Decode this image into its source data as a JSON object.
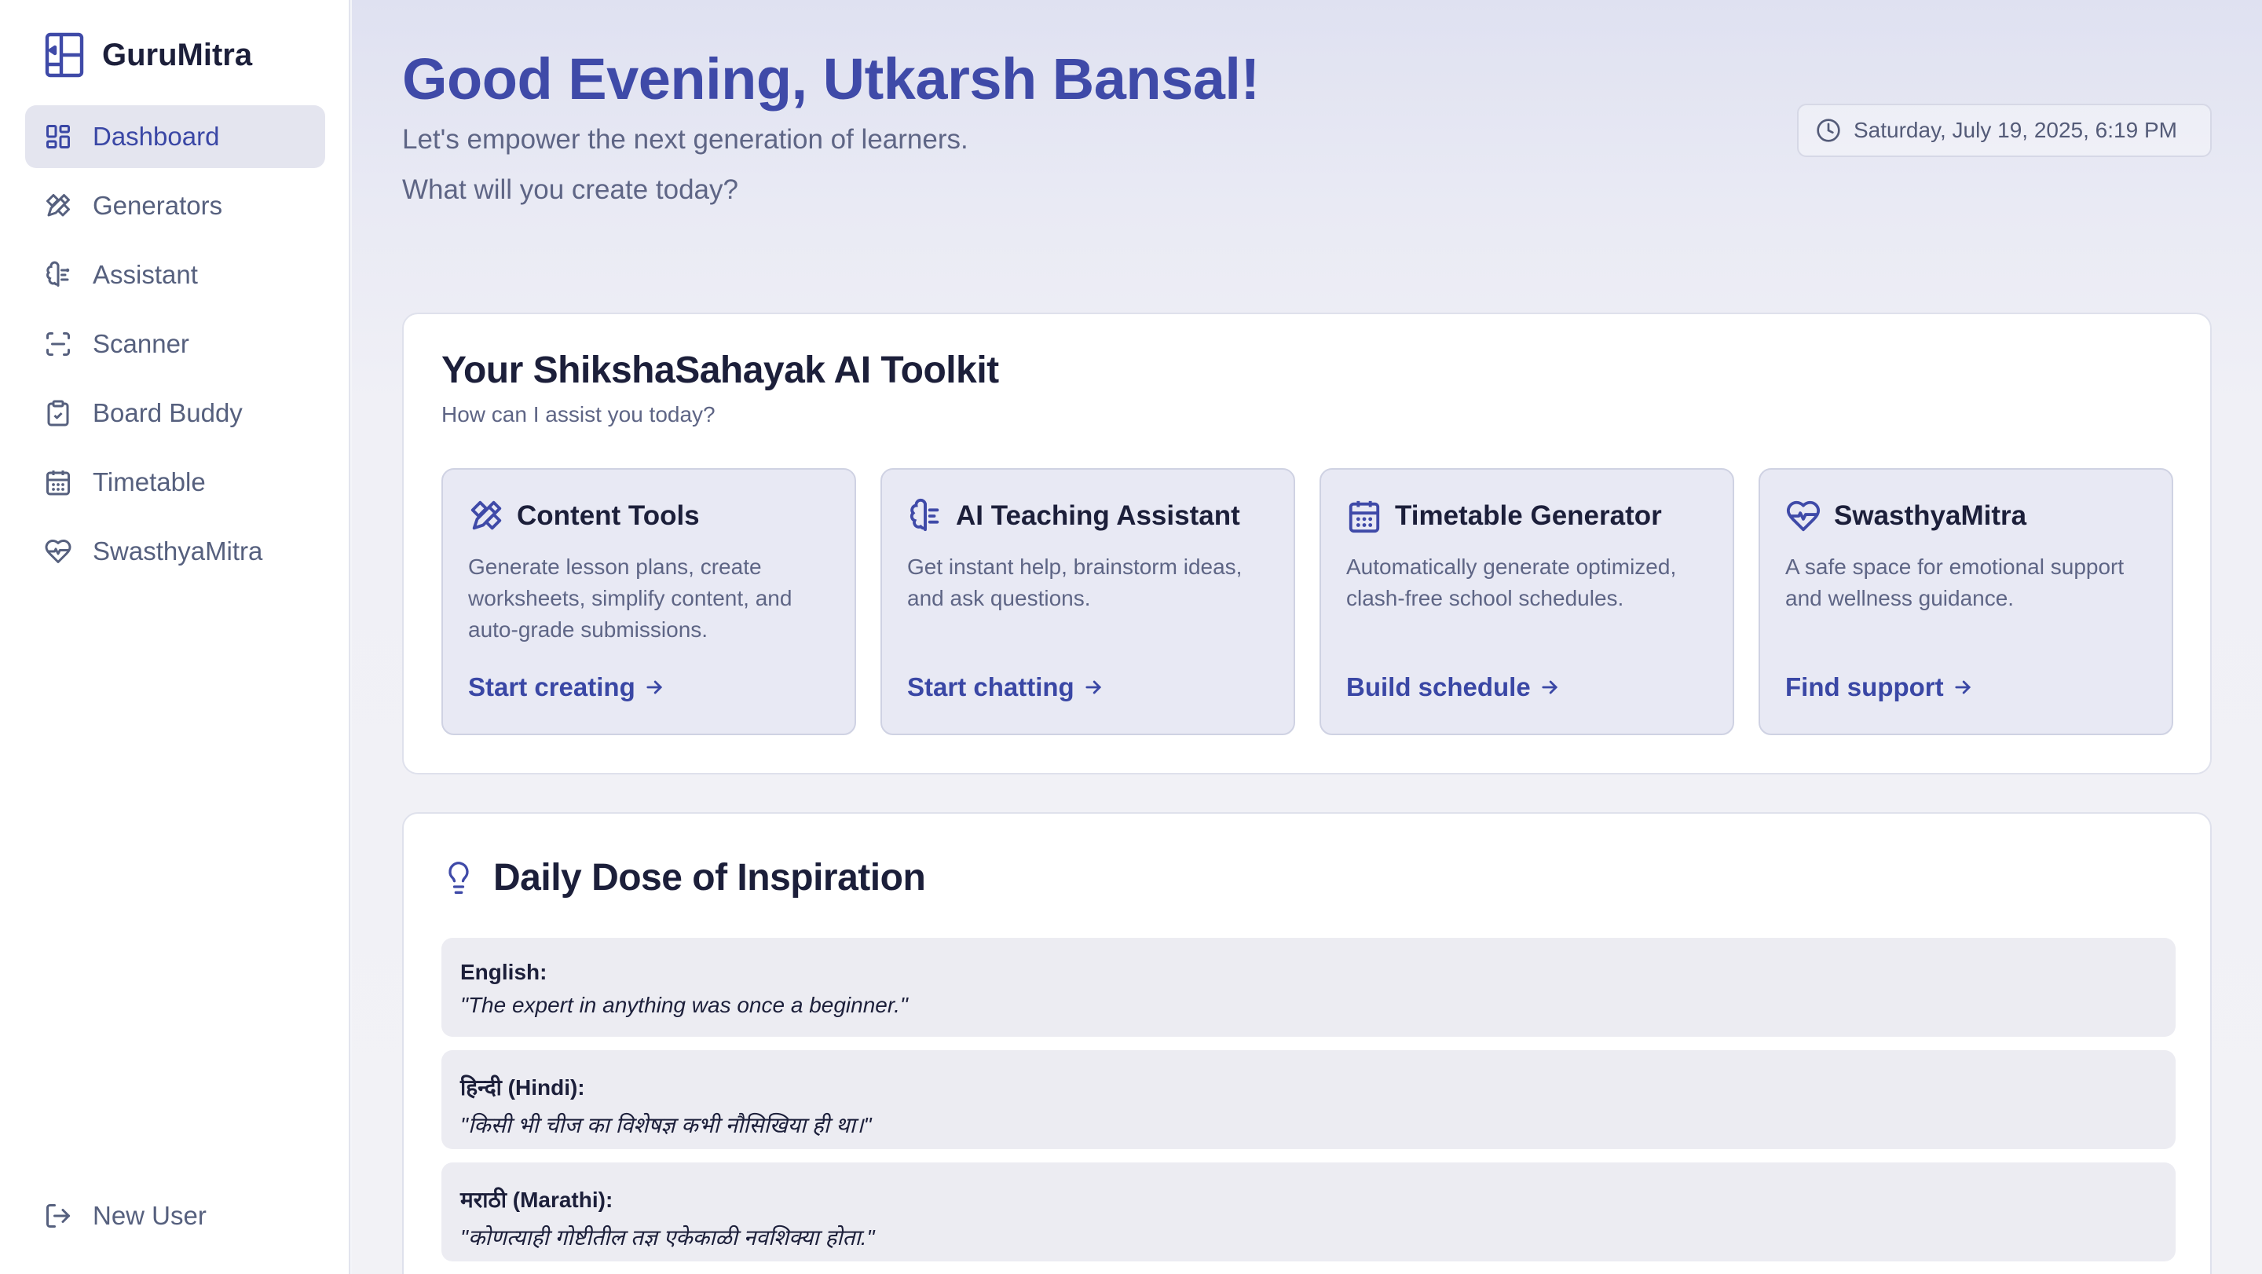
{
  "app": {
    "name": "GuruMitra"
  },
  "sidebar": {
    "items": [
      {
        "label": "Dashboard",
        "icon": "dashboard-icon",
        "active": true
      },
      {
        "label": "Generators",
        "icon": "pencil-ruler-icon"
      },
      {
        "label": "Assistant",
        "icon": "brain-icon"
      },
      {
        "label": "Scanner",
        "icon": "scan-icon"
      },
      {
        "label": "Board Buddy",
        "icon": "clipboard-icon"
      },
      {
        "label": "Timetable",
        "icon": "calendar-icon"
      },
      {
        "label": "SwasthyaMitra",
        "icon": "heart-pulse-icon"
      }
    ],
    "logout_label": "New User"
  },
  "header": {
    "greeting": "Good Evening, Utkarsh Bansal!",
    "subtitle_1": "Let's empower the next generation of learners.",
    "subtitle_2": "What will you create today?",
    "datetime": "Saturday, July 19, 2025, 6:19 PM"
  },
  "toolkit": {
    "title": "Your ShikshaSahayak AI Toolkit",
    "subtitle": "How can I assist you today?",
    "tools": [
      {
        "title": "Content Tools",
        "desc": "Generate lesson plans, create worksheets, simplify content, and auto-grade submissions.",
        "link": "Start creating",
        "icon": "pencil-ruler-icon"
      },
      {
        "title": "AI Teaching Assistant",
        "desc": "Get instant help, brainstorm ideas, and ask questions.",
        "link": "Start chatting",
        "icon": "brain-icon"
      },
      {
        "title": "Timetable Generator",
        "desc": "Automatically generate optimized, clash-free school schedules.",
        "link": "Build schedule",
        "icon": "calendar-icon"
      },
      {
        "title": "SwasthyaMitra",
        "desc": "A safe space for emotional support and wellness guidance.",
        "link": "Find support",
        "icon": "heart-pulse-icon"
      }
    ]
  },
  "inspiration": {
    "title": "Daily Dose of Inspiration",
    "quotes": [
      {
        "lang": "English:",
        "text": "\"The expert in anything was once a beginner.\""
      },
      {
        "lang": "हिन्दी (Hindi):",
        "text": "\"किसी भी चीज का विशेषज्ञ कभी नौसिखिया ही था।\""
      },
      {
        "lang": "मराठी (Marathi):",
        "text": "\"कोणत्याही गोष्टीतील तज्ञ एकेकाळी नवशिक्या होता.\""
      }
    ]
  },
  "colors": {
    "accent": "#3f4aa8",
    "active_bg": "#e4e5ef",
    "tool_bg": "#e8e9f4"
  }
}
